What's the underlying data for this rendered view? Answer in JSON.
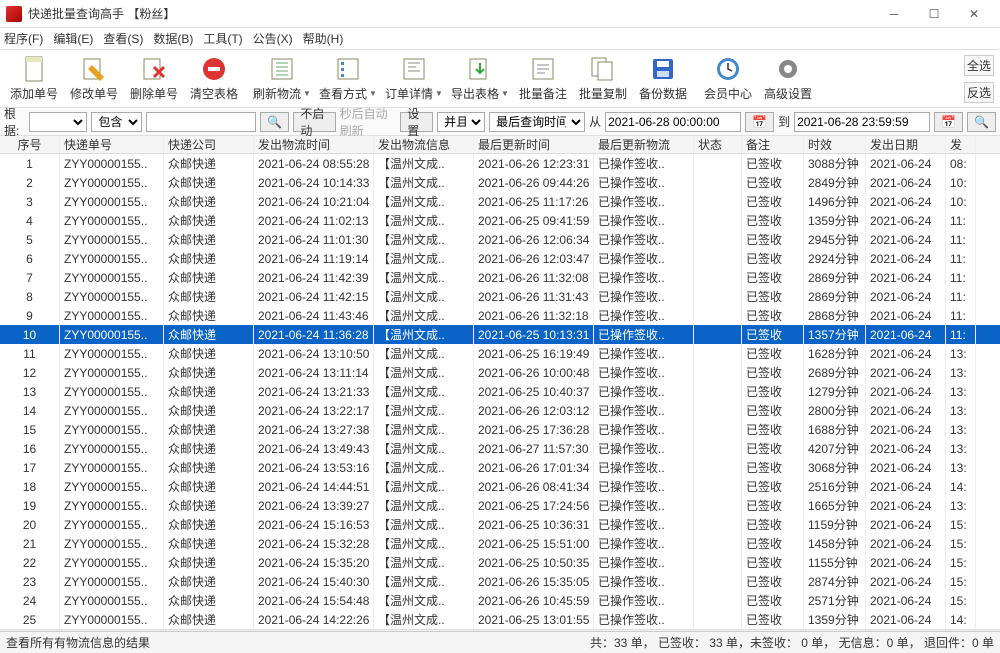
{
  "window": {
    "title": "快递批量查询高手  【粉丝】"
  },
  "menus": {
    "program": "程序(F)",
    "edit": "编辑(E)",
    "view": "查看(S)",
    "data": "数据(B)",
    "tool": "工具(T)",
    "notice": "公告(X)",
    "help": "帮助(H)"
  },
  "toolbar": {
    "add": "添加单号",
    "edit": "修改单号",
    "delete": "删除单号",
    "clear": "清空表格",
    "refresh": "刷新物流",
    "viewtype": "查看方式",
    "detail": "订单详情",
    "export": "导出表格",
    "batchnote": "批量备注",
    "batchcopy": "批量复制",
    "backup": "备份数据",
    "member": "会员中心",
    "advanced": "高级设置",
    "selectall": "全选",
    "invert": "反选"
  },
  "filter": {
    "root": "根据:",
    "contain": "包含",
    "disable": "不启动",
    "autorefresh": "秒后自动刷新",
    "set": "设置",
    "and": "并且",
    "lastquery": "最后查询时间",
    "from": "从",
    "fromval": "2021-06-28 00:00:00",
    "to": "到",
    "toval": "2021-06-28 23:59:59"
  },
  "columns": {
    "idx": "序号",
    "trackno": "快递单号",
    "company": "快递公司",
    "sendtime": "发出物流时间",
    "sendinfo": "发出物流信息",
    "lastupdate": "最后更新时间",
    "lastinfo": "最后更新物流",
    "status": "状态",
    "remark": "备注",
    "duration": "时效",
    "senddate": "发出日期",
    "extra": "发"
  },
  "rows": [
    {
      "i": "1",
      "no": "ZYY00000155..",
      "co": "众邮快递",
      "st": "2021-06-24 08:55:28",
      "si": "【温州文成..",
      "lu": "2021-06-26 12:23:31",
      "li": "已操作签收..",
      "s": "已签收",
      "d": "3088分钟",
      "sd": "2021-06-24",
      "x": "08:"
    },
    {
      "i": "2",
      "no": "ZYY00000155..",
      "co": "众邮快递",
      "st": "2021-06-24 10:14:33",
      "si": "【温州文成..",
      "lu": "2021-06-26 09:44:26",
      "li": "已操作签收..",
      "s": "已签收",
      "d": "2849分钟",
      "sd": "2021-06-24",
      "x": "10:"
    },
    {
      "i": "3",
      "no": "ZYY00000155..",
      "co": "众邮快递",
      "st": "2021-06-24 10:21:04",
      "si": "【温州文成..",
      "lu": "2021-06-25 11:17:26",
      "li": "已操作签收..",
      "s": "已签收",
      "d": "1496分钟",
      "sd": "2021-06-24",
      "x": "10:"
    },
    {
      "i": "4",
      "no": "ZYY00000155..",
      "co": "众邮快递",
      "st": "2021-06-24 11:02:13",
      "si": "【温州文成..",
      "lu": "2021-06-25 09:41:59",
      "li": "已操作签收..",
      "s": "已签收",
      "d": "1359分钟",
      "sd": "2021-06-24",
      "x": "11:"
    },
    {
      "i": "5",
      "no": "ZYY00000155..",
      "co": "众邮快递",
      "st": "2021-06-24 11:01:30",
      "si": "【温州文成..",
      "lu": "2021-06-26 12:06:34",
      "li": "已操作签收..",
      "s": "已签收",
      "d": "2945分钟",
      "sd": "2021-06-24",
      "x": "11:"
    },
    {
      "i": "6",
      "no": "ZYY00000155..",
      "co": "众邮快递",
      "st": "2021-06-24 11:19:14",
      "si": "【温州文成..",
      "lu": "2021-06-26 12:03:47",
      "li": "已操作签收..",
      "s": "已签收",
      "d": "2924分钟",
      "sd": "2021-06-24",
      "x": "11:"
    },
    {
      "i": "7",
      "no": "ZYY00000155..",
      "co": "众邮快递",
      "st": "2021-06-24 11:42:39",
      "si": "【温州文成..",
      "lu": "2021-06-26 11:32:08",
      "li": "已操作签收..",
      "s": "已签收",
      "d": "2869分钟",
      "sd": "2021-06-24",
      "x": "11:"
    },
    {
      "i": "8",
      "no": "ZYY00000155..",
      "co": "众邮快递",
      "st": "2021-06-24 11:42:15",
      "si": "【温州文成..",
      "lu": "2021-06-26 11:31:43",
      "li": "已操作签收..",
      "s": "已签收",
      "d": "2869分钟",
      "sd": "2021-06-24",
      "x": "11:"
    },
    {
      "i": "9",
      "no": "ZYY00000155..",
      "co": "众邮快递",
      "st": "2021-06-24 11:43:46",
      "si": "【温州文成..",
      "lu": "2021-06-26 11:32:18",
      "li": "已操作签收..",
      "s": "已签收",
      "d": "2868分钟",
      "sd": "2021-06-24",
      "x": "11:"
    },
    {
      "i": "10",
      "no": "ZYY00000155..",
      "co": "众邮快递",
      "st": "2021-06-24 11:36:28",
      "si": "【温州文成..",
      "lu": "2021-06-25 10:13:31",
      "li": "已操作签收..",
      "s": "已签收",
      "d": "1357分钟",
      "sd": "2021-06-24",
      "x": "11:",
      "sel": true
    },
    {
      "i": "11",
      "no": "ZYY00000155..",
      "co": "众邮快递",
      "st": "2021-06-24 13:10:50",
      "si": "【温州文成..",
      "lu": "2021-06-25 16:19:49",
      "li": "已操作签收..",
      "s": "已签收",
      "d": "1628分钟",
      "sd": "2021-06-24",
      "x": "13:"
    },
    {
      "i": "12",
      "no": "ZYY00000155..",
      "co": "众邮快递",
      "st": "2021-06-24 13:11:14",
      "si": "【温州文成..",
      "lu": "2021-06-26 10:00:48",
      "li": "已操作签收..",
      "s": "已签收",
      "d": "2689分钟",
      "sd": "2021-06-24",
      "x": "13:"
    },
    {
      "i": "13",
      "no": "ZYY00000155..",
      "co": "众邮快递",
      "st": "2021-06-24 13:21:33",
      "si": "【温州文成..",
      "lu": "2021-06-25 10:40:37",
      "li": "已操作签收..",
      "s": "已签收",
      "d": "1279分钟",
      "sd": "2021-06-24",
      "x": "13:"
    },
    {
      "i": "14",
      "no": "ZYY00000155..",
      "co": "众邮快递",
      "st": "2021-06-24 13:22:17",
      "si": "【温州文成..",
      "lu": "2021-06-26 12:03:12",
      "li": "已操作签收..",
      "s": "已签收",
      "d": "2800分钟",
      "sd": "2021-06-24",
      "x": "13:"
    },
    {
      "i": "15",
      "no": "ZYY00000155..",
      "co": "众邮快递",
      "st": "2021-06-24 13:27:38",
      "si": "【温州文成..",
      "lu": "2021-06-25 17:36:28",
      "li": "已操作签收..",
      "s": "已签收",
      "d": "1688分钟",
      "sd": "2021-06-24",
      "x": "13:"
    },
    {
      "i": "16",
      "no": "ZYY00000155..",
      "co": "众邮快递",
      "st": "2021-06-24 13:49:43",
      "si": "【温州文成..",
      "lu": "2021-06-27 11:57:30",
      "li": "已操作签收..",
      "s": "已签收",
      "d": "4207分钟",
      "sd": "2021-06-24",
      "x": "13:"
    },
    {
      "i": "17",
      "no": "ZYY00000155..",
      "co": "众邮快递",
      "st": "2021-06-24 13:53:16",
      "si": "【温州文成..",
      "lu": "2021-06-26 17:01:34",
      "li": "已操作签收..",
      "s": "已签收",
      "d": "3068分钟",
      "sd": "2021-06-24",
      "x": "13:"
    },
    {
      "i": "18",
      "no": "ZYY00000155..",
      "co": "众邮快递",
      "st": "2021-06-24 14:44:51",
      "si": "【温州文成..",
      "lu": "2021-06-26 08:41:34",
      "li": "已操作签收..",
      "s": "已签收",
      "d": "2516分钟",
      "sd": "2021-06-24",
      "x": "14:"
    },
    {
      "i": "19",
      "no": "ZYY00000155..",
      "co": "众邮快递",
      "st": "2021-06-24 13:39:27",
      "si": "【温州文成..",
      "lu": "2021-06-25 17:24:56",
      "li": "已操作签收..",
      "s": "已签收",
      "d": "1665分钟",
      "sd": "2021-06-24",
      "x": "13:"
    },
    {
      "i": "20",
      "no": "ZYY00000155..",
      "co": "众邮快递",
      "st": "2021-06-24 15:16:53",
      "si": "【温州文成..",
      "lu": "2021-06-25 10:36:31",
      "li": "已操作签收..",
      "s": "已签收",
      "d": "1159分钟",
      "sd": "2021-06-24",
      "x": "15:"
    },
    {
      "i": "21",
      "no": "ZYY00000155..",
      "co": "众邮快递",
      "st": "2021-06-24 15:32:28",
      "si": "【温州文成..",
      "lu": "2021-06-25 15:51:00",
      "li": "已操作签收..",
      "s": "已签收",
      "d": "1458分钟",
      "sd": "2021-06-24",
      "x": "15:"
    },
    {
      "i": "22",
      "no": "ZYY00000155..",
      "co": "众邮快递",
      "st": "2021-06-24 15:35:20",
      "si": "【温州文成..",
      "lu": "2021-06-25 10:50:35",
      "li": "已操作签收..",
      "s": "已签收",
      "d": "1155分钟",
      "sd": "2021-06-24",
      "x": "15:"
    },
    {
      "i": "23",
      "no": "ZYY00000155..",
      "co": "众邮快递",
      "st": "2021-06-24 15:40:30",
      "si": "【温州文成..",
      "lu": "2021-06-26 15:35:05",
      "li": "已操作签收..",
      "s": "已签收",
      "d": "2874分钟",
      "sd": "2021-06-24",
      "x": "15:"
    },
    {
      "i": "24",
      "no": "ZYY00000155..",
      "co": "众邮快递",
      "st": "2021-06-24 15:54:48",
      "si": "【温州文成..",
      "lu": "2021-06-26 10:45:59",
      "li": "已操作签收..",
      "s": "已签收",
      "d": "2571分钟",
      "sd": "2021-06-24",
      "x": "15:"
    },
    {
      "i": "25",
      "no": "ZYY00000155..",
      "co": "众邮快递",
      "st": "2021-06-24 14:22:26",
      "si": "【温州文成..",
      "lu": "2021-06-25 13:01:55",
      "li": "已操作签收..",
      "s": "已签收",
      "d": "1359分钟",
      "sd": "2021-06-24",
      "x": "14:"
    }
  ],
  "status": {
    "left": "查看所有有物流信息的结果",
    "right": "共：33 单，  已签收：  33 单，未签收：  0 单，  无信息：0 单，  退回件：0 单"
  }
}
